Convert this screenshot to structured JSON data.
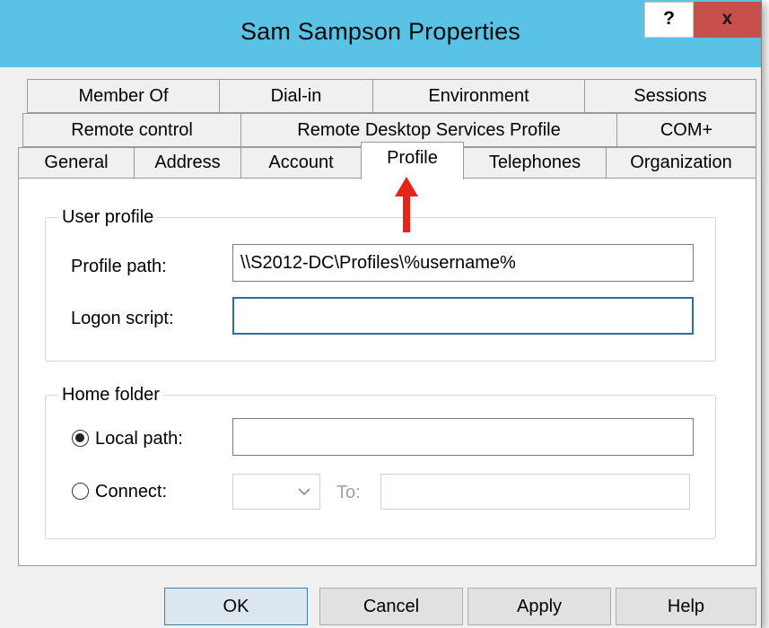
{
  "window": {
    "title": "Sam Sampson Properties",
    "help_glyph": "?",
    "close_glyph": "x"
  },
  "tabs": {
    "row1": [
      "Member Of",
      "Dial-in",
      "Environment",
      "Sessions"
    ],
    "row2": [
      "Remote control",
      "Remote Desktop Services Profile",
      "COM+"
    ],
    "row3": [
      "General",
      "Address",
      "Account",
      "Profile",
      "Telephones",
      "Organization"
    ],
    "active": "Profile"
  },
  "user_profile": {
    "group_label": "User profile",
    "profile_path_label": "Profile path:",
    "profile_path_value": "\\\\S2012-DC\\Profiles\\%username%",
    "logon_script_label": "Logon script:",
    "logon_script_value": ""
  },
  "home_folder": {
    "group_label": "Home folder",
    "local_path_label": "Local path:",
    "local_path_value": "",
    "local_path_selected": true,
    "connect_label": "Connect:",
    "connect_drive_value": "",
    "to_label": "To:",
    "to_value": ""
  },
  "buttons": {
    "ok": "OK",
    "cancel": "Cancel",
    "apply": "Apply",
    "help": "Help"
  },
  "colors": {
    "titlebar": "#5ac3e5",
    "close_button": "#c7504a",
    "annotation_arrow": "#e8231b",
    "focus_border": "#2f6ea0"
  },
  "icons": {
    "annotation": "red-up-arrow",
    "dropdown": "chevron-down"
  }
}
